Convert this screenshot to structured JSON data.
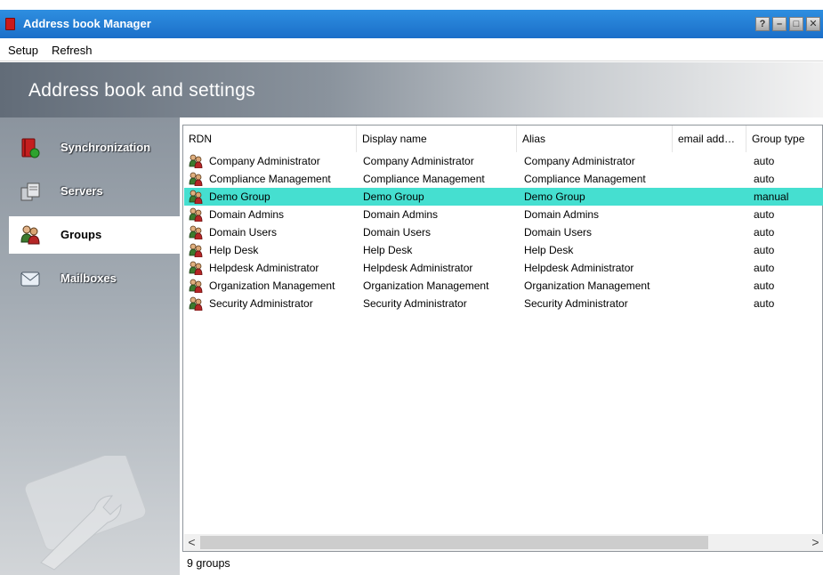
{
  "window": {
    "title": "Address book Manager",
    "controls": [
      "?",
      "–",
      "□",
      "✕"
    ]
  },
  "menu": [
    "Setup",
    "Refresh"
  ],
  "header": {
    "title": "Address book and settings"
  },
  "nav": {
    "items": [
      {
        "label": "Synchronization",
        "icon": "book-sync-icon",
        "active": false
      },
      {
        "label": "Servers",
        "icon": "servers-icon",
        "active": false
      },
      {
        "label": "Groups",
        "icon": "groups-icon",
        "active": true
      },
      {
        "label": "Mailboxes",
        "icon": "mailbox-icon",
        "active": false
      }
    ]
  },
  "table": {
    "columns": [
      "RDN",
      "Display name",
      "Alias",
      "email add…",
      "Group type"
    ],
    "rows": [
      {
        "rdn": "Company Administrator",
        "display": "Company Administrator",
        "alias": "Company Administrator",
        "email": "",
        "type": "auto",
        "selected": false
      },
      {
        "rdn": "Compliance Management",
        "display": "Compliance Management",
        "alias": "Compliance Management",
        "email": "",
        "type": "auto",
        "selected": false
      },
      {
        "rdn": "Demo Group",
        "display": "Demo Group",
        "alias": "Demo Group",
        "email": "",
        "type": "manual",
        "selected": true
      },
      {
        "rdn": "Domain Admins",
        "display": "Domain Admins",
        "alias": "Domain Admins",
        "email": "",
        "type": "auto",
        "selected": false
      },
      {
        "rdn": "Domain Users",
        "display": "Domain Users",
        "alias": "Domain Users",
        "email": "",
        "type": "auto",
        "selected": false
      },
      {
        "rdn": "Help Desk",
        "display": "Help Desk",
        "alias": "Help Desk",
        "email": "",
        "type": "auto",
        "selected": false
      },
      {
        "rdn": "Helpdesk Administrator",
        "display": "Helpdesk Administrator",
        "alias": "Helpdesk Administrator",
        "email": "",
        "type": "auto",
        "selected": false
      },
      {
        "rdn": "Organization Management",
        "display": "Organization Management",
        "alias": "Organization Management",
        "email": "",
        "type": "auto",
        "selected": false
      },
      {
        "rdn": "Security Administrator",
        "display": "Security Administrator",
        "alias": "Security Administrator",
        "email": "",
        "type": "auto",
        "selected": false
      }
    ]
  },
  "scrollbar": {
    "left_arrow": "<",
    "right_arrow": ">"
  },
  "status": {
    "text": "9 groups"
  },
  "colors": {
    "selection": "#45dfd0",
    "titlebar": "#1e73cc"
  }
}
